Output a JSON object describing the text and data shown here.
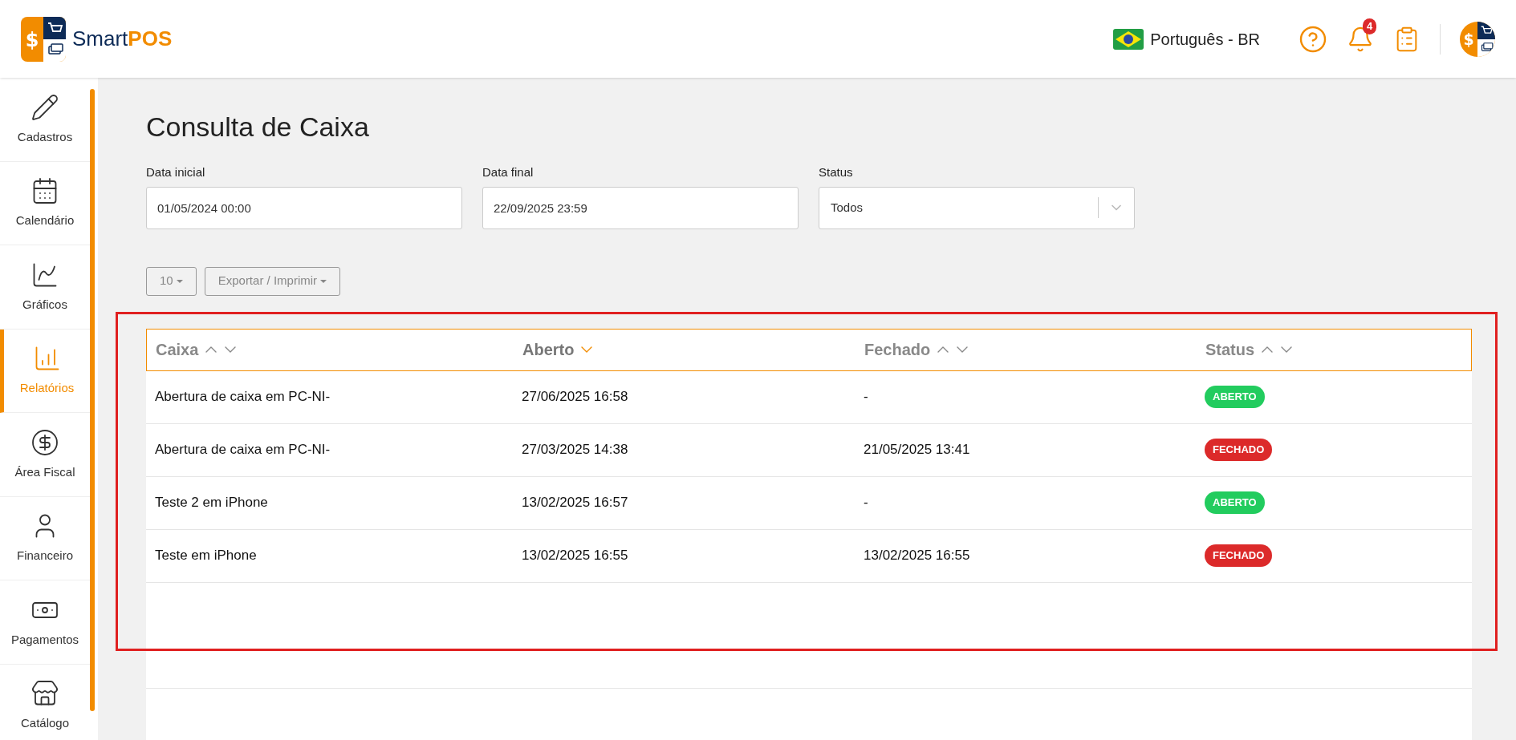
{
  "header": {
    "logo_symbol": "$",
    "avatar_symbol": "$",
    "brand_left": "Smart",
    "brand_right": "POS",
    "language": "Português - BR",
    "notification_count": "4"
  },
  "sidebar": {
    "items": [
      {
        "label": "Cadastros",
        "selected": false
      },
      {
        "label": "Calendário",
        "selected": false
      },
      {
        "label": "Gráficos",
        "selected": false
      },
      {
        "label": "Relatórios",
        "selected": true
      },
      {
        "label": "Área Fiscal",
        "selected": false
      },
      {
        "label": "Financeiro",
        "selected": false
      },
      {
        "label": "Pagamentos",
        "selected": false
      },
      {
        "label": "Catálogo",
        "selected": false
      }
    ]
  },
  "page_title": "Consulta de Caixa",
  "filters": [
    {
      "label": "Data inicial",
      "kind": "input",
      "value": "01/05/2024 00:00"
    },
    {
      "label": "Data final",
      "kind": "input",
      "value": "22/09/2025 23:59"
    },
    {
      "label": "Status",
      "kind": "select",
      "value": "Todos"
    }
  ],
  "toolbar": {
    "page_size": "10",
    "export": "Exportar / Imprimir"
  },
  "table": {
    "columns": [
      {
        "label": "Caixa",
        "sorted": false
      },
      {
        "label": "Aberto",
        "sorted": true
      },
      {
        "label": "Fechado",
        "sorted": false
      },
      {
        "label": "Status",
        "sorted": false
      }
    ],
    "rows": [
      {
        "caixa": "Abertura de caixa em PC-NI-",
        "aberto": "27/06/2025 16:58",
        "fechado": "-",
        "status": "ABERTO",
        "color": "#22cc5e"
      },
      {
        "caixa": "Abertura de caixa em PC-NI-",
        "aberto": "27/03/2025 14:38",
        "fechado": "21/05/2025 13:41",
        "status": "FECHADO",
        "color": "#dc2a2a"
      },
      {
        "caixa": "Teste 2 em iPhone",
        "aberto": "13/02/2025 16:57",
        "fechado": "-",
        "status": "ABERTO",
        "color": "#22cc5e"
      },
      {
        "caixa": "Teste em iPhone",
        "aberto": "13/02/2025 16:55",
        "fechado": "13/02/2025 16:55",
        "status": "FECHADO",
        "color": "#dc2a2a"
      }
    ]
  }
}
